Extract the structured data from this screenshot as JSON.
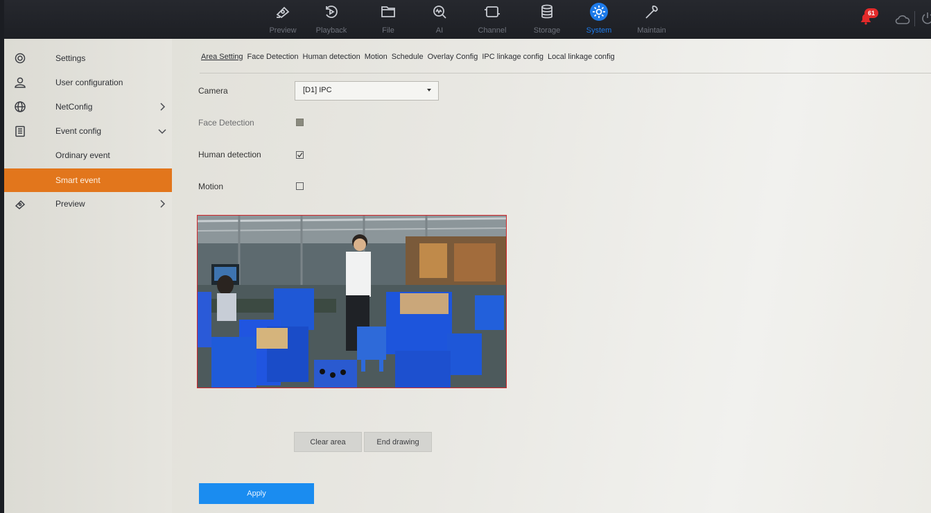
{
  "topnav": {
    "items": [
      {
        "label": "Preview",
        "icon": "preview-camera-icon"
      },
      {
        "label": "Playback",
        "icon": "playback-icon"
      },
      {
        "label": "File",
        "icon": "folder-icon"
      },
      {
        "label": "AI",
        "icon": "ai-search-icon"
      },
      {
        "label": "Channel",
        "icon": "channel-icon"
      },
      {
        "label": "Storage",
        "icon": "storage-icon"
      },
      {
        "label": "System",
        "icon": "system-gear-icon",
        "active": true
      },
      {
        "label": "Maintain",
        "icon": "wrench-icon"
      }
    ],
    "notification_count": "61",
    "accent_color": "#1e7bea"
  },
  "sidebar": {
    "items": [
      {
        "label": "Settings",
        "icon": "gear-icon"
      },
      {
        "label": "User configuration",
        "icon": "user-icon"
      },
      {
        "label": "NetConfig",
        "icon": "globe-icon",
        "chevron": "right"
      },
      {
        "label": "Event config",
        "icon": "clipboard-icon",
        "chevron": "down"
      },
      {
        "label": "Ordinary event"
      },
      {
        "label": "Smart event",
        "active": true
      },
      {
        "label": "Preview",
        "icon": "preview-camera-icon",
        "chevron": "right"
      }
    ],
    "active_color": "#e2761c"
  },
  "tabs": [
    {
      "label": "Area Setting",
      "active": true
    },
    {
      "label": "Face Detection"
    },
    {
      "label": "Human detection"
    },
    {
      "label": "Motion"
    },
    {
      "label": "Schedule"
    },
    {
      "label": "Overlay Config"
    },
    {
      "label": "IPC linkage config"
    },
    {
      "label": "Local linkage config"
    }
  ],
  "form": {
    "camera_label": "Camera",
    "camera_value": "[D1] IPC",
    "face_detection_label": "Face Detection",
    "face_detection_checked": false,
    "face_detection_disabled": true,
    "human_detection_label": "Human detection",
    "human_detection_checked": true,
    "motion_label": "Motion",
    "motion_checked": false
  },
  "buttons": {
    "clear_area": "Clear area",
    "end_drawing": "End drawing",
    "apply": "Apply"
  }
}
